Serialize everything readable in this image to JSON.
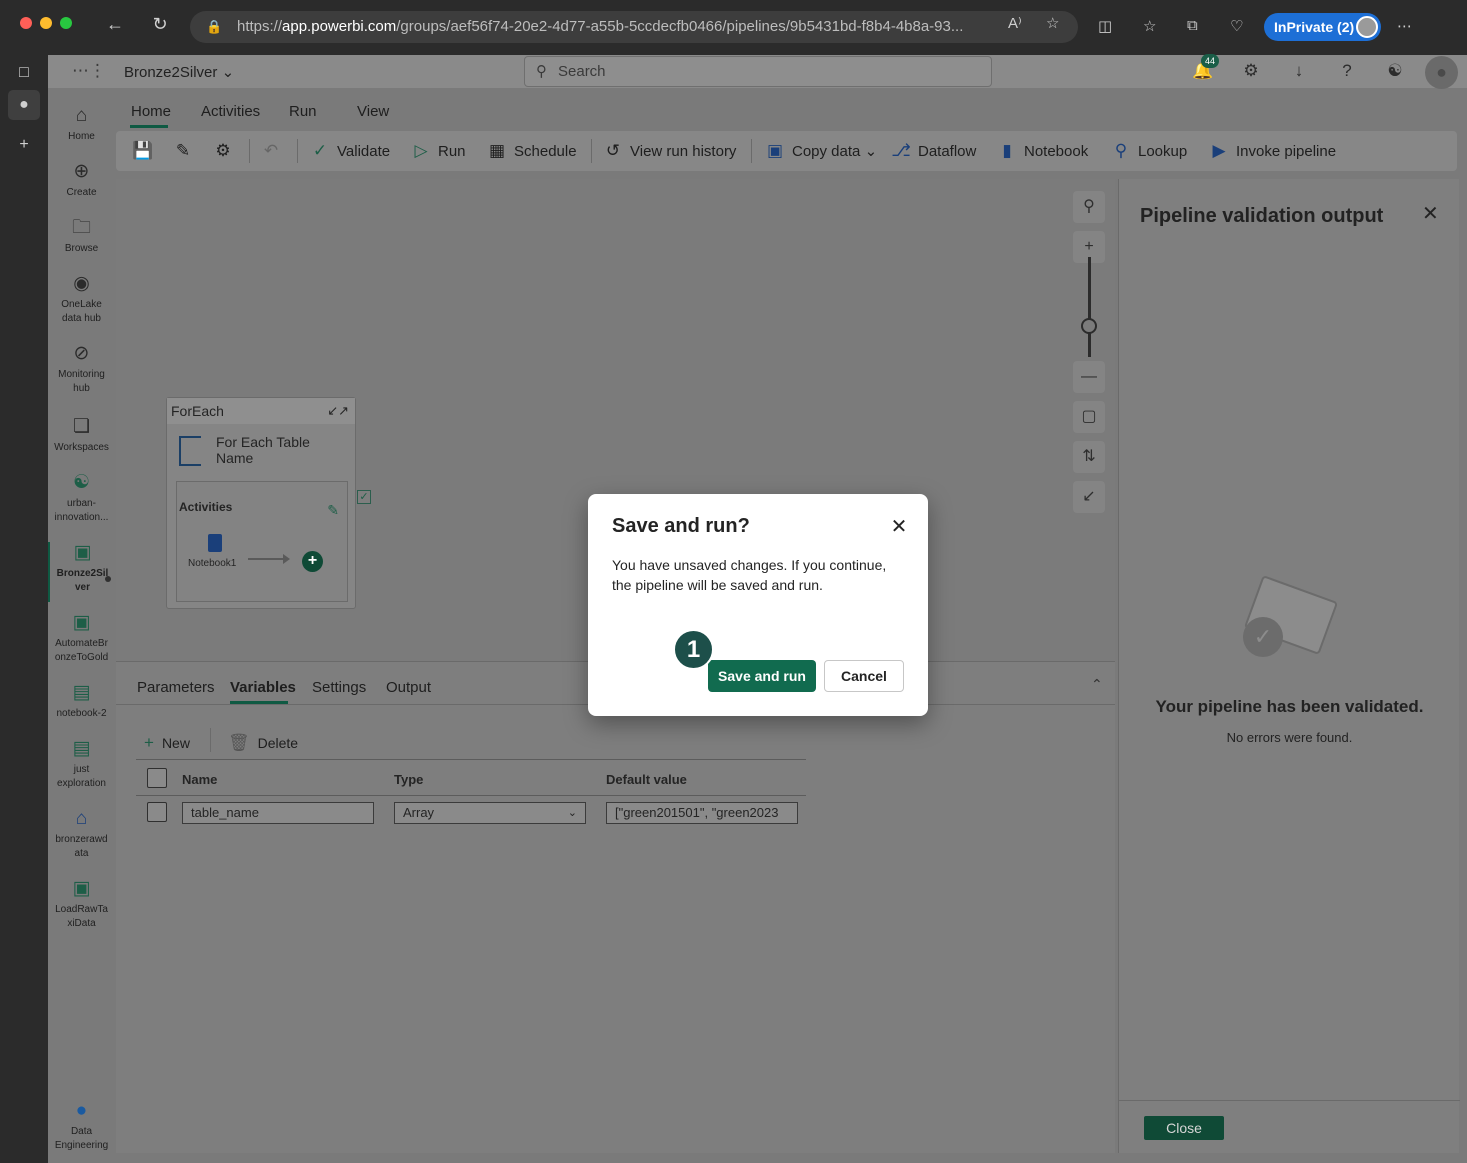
{
  "browser": {
    "url_prefix": "https://",
    "url_host": "app.powerbi.com",
    "url_path": "/groups/aef56f74-20e2-4d77-a55b-5ccdecfb0466/pipelines/9b5431bd-f8b4-4b8a-93...",
    "inprivate_label": "InPrivate (2)"
  },
  "header": {
    "workspace_name": "Bronze2Silver",
    "search_placeholder": "Search",
    "notification_count": "44"
  },
  "leftnav": {
    "items": [
      {
        "label": "Home",
        "icon": "home-icon"
      },
      {
        "label": "Create",
        "icon": "create-icon"
      },
      {
        "label": "Browse",
        "icon": "folder-icon"
      },
      {
        "label": "OneLake data hub",
        "icon": "onelake-icon"
      },
      {
        "label": "Monitoring hub",
        "icon": "monitoring-icon"
      },
      {
        "label": "Workspaces",
        "icon": "workspaces-icon"
      },
      {
        "label": "urban-innovation...",
        "icon": "workspace-icon"
      },
      {
        "label": "Bronze2Silver",
        "icon": "pipeline-icon"
      },
      {
        "label": "AutomateBronzeToGold",
        "icon": "pipeline-icon"
      },
      {
        "label": "notebook-2",
        "icon": "notebook-icon"
      },
      {
        "label": "just exploration",
        "icon": "notebook-icon"
      },
      {
        "label": "bronzerawdata",
        "icon": "lakehouse-icon"
      },
      {
        "label": "LoadRawTaxiData",
        "icon": "pipeline-icon"
      },
      {
        "label": "Data Engineering",
        "icon": "data-engineering-icon"
      }
    ]
  },
  "ribbon": {
    "tabs": [
      "Home",
      "Activities",
      "Run",
      "View"
    ],
    "toolbar": {
      "validate": "Validate",
      "run": "Run",
      "schedule": "Schedule",
      "view_run_history": "View run history",
      "copy_data": "Copy data",
      "dataflow": "Dataflow",
      "notebook": "Notebook",
      "lookup": "Lookup",
      "invoke_pipeline": "Invoke pipeline"
    }
  },
  "canvas": {
    "foreach_header": "ForEach",
    "foreach_title": "For Each Table Name",
    "activities_label": "Activities",
    "notebook_label": "Notebook1"
  },
  "bottom_panel": {
    "tabs": [
      "Parameters",
      "Variables",
      "Settings",
      "Output"
    ],
    "new_label": "New",
    "delete_label": "Delete",
    "columns": {
      "name": "Name",
      "type": "Type",
      "default": "Default value"
    },
    "rows": [
      {
        "name": "table_name",
        "type": "Array",
        "default": "[\"green201501\", \"green2023"
      }
    ]
  },
  "validation_panel": {
    "title": "Pipeline validation output",
    "message": "Your pipeline has been validated.",
    "sub": "No errors were found.",
    "close_label": "Close"
  },
  "dialog": {
    "title": "Save and run?",
    "body": "You have unsaved changes. If you continue, the pipeline will be saved and run.",
    "primary": "Save and run",
    "secondary": "Cancel",
    "step_badge": "1"
  },
  "colors": {
    "accent": "#116b4f",
    "inprivate": "#1d6fd6"
  }
}
